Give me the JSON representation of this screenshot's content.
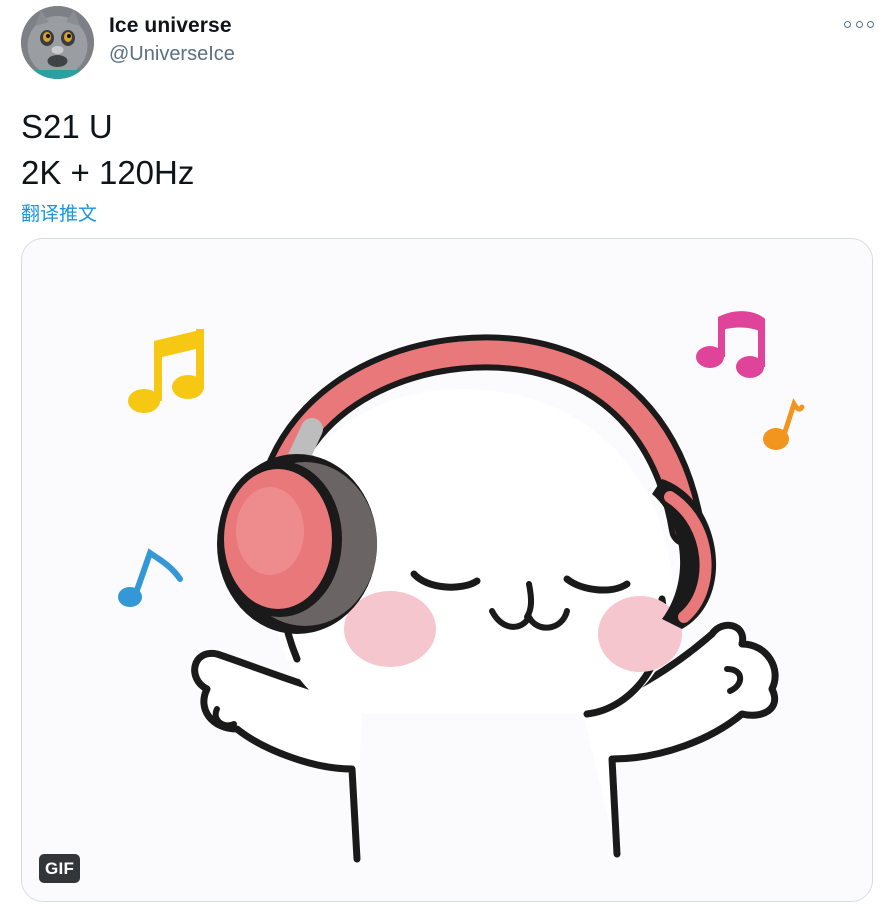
{
  "author": {
    "display_name": "Ice universe",
    "handle": "@UniverseIce",
    "avatar_icon": "cat-avatar-icon"
  },
  "tweet": {
    "lines": [
      "S21 U",
      "2K + 120Hz"
    ],
    "translate_label": "翻译推文"
  },
  "media": {
    "badge": "GIF",
    "illustration": "bear-with-headphones-music-notes",
    "colors": {
      "headphones": "#e8787a",
      "note_yellow": "#f6c814",
      "note_pink": "#e0449a",
      "note_orange": "#f2951f",
      "note_blue": "#3598d6"
    }
  },
  "menu_icon": "more-options-icon"
}
